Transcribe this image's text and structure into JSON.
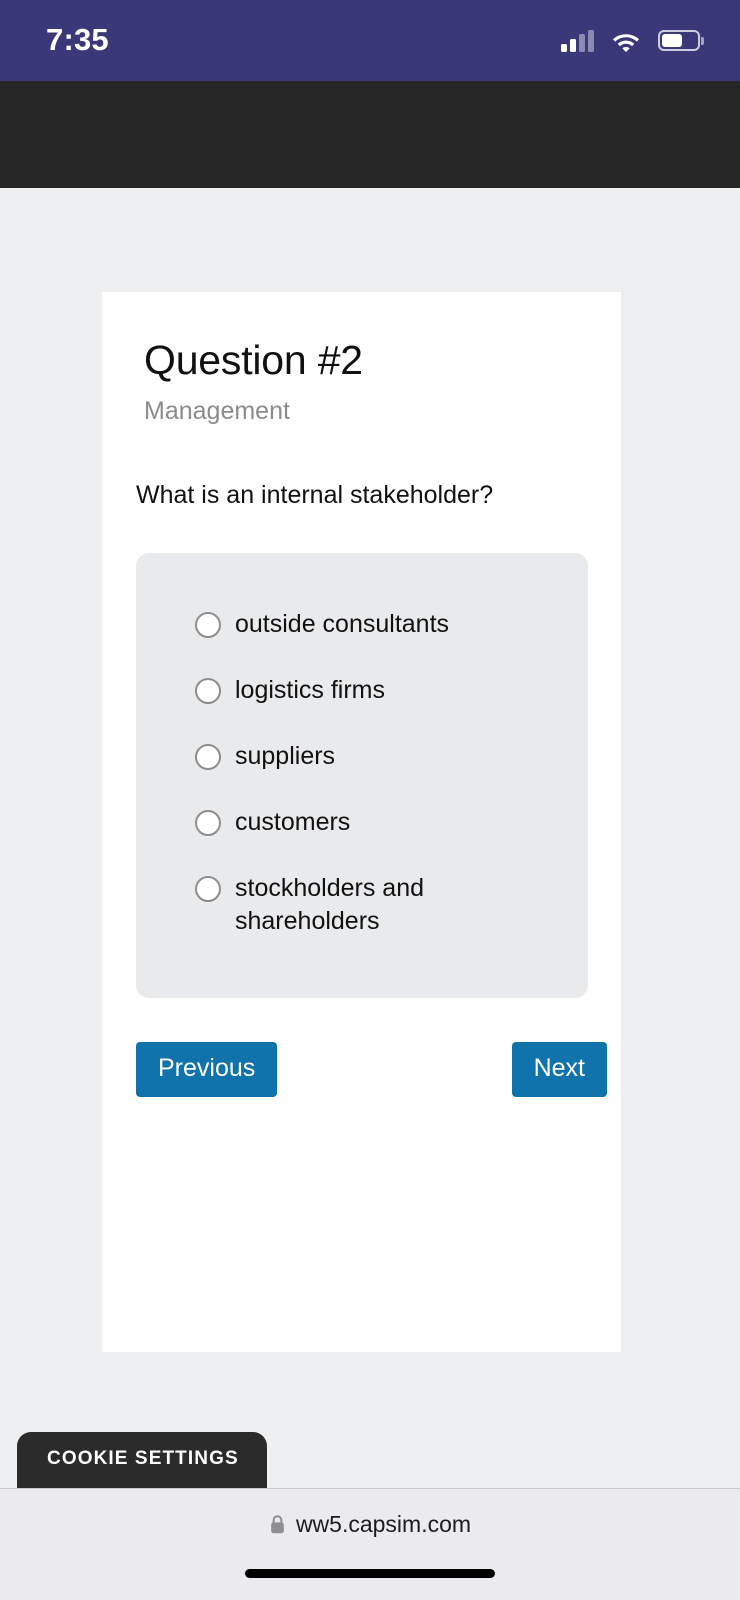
{
  "status_bar": {
    "time": "7:35",
    "background_color": "#3b3879",
    "signal_icon": "cellular-signal-icon",
    "signal_bars_filled": 2,
    "signal_bars_total": 4,
    "wifi_icon": "wifi-icon",
    "battery_icon": "battery-icon",
    "battery_level_percent": 58
  },
  "browser_chrome": {
    "top_band_color": "#262626"
  },
  "quiz": {
    "title": "Question #2",
    "category": "Management",
    "prompt": "What is an internal stakeholder?",
    "options": [
      {
        "label": "outside consultants",
        "selected": false
      },
      {
        "label": "logistics firms",
        "selected": false
      },
      {
        "label": "suppliers",
        "selected": false
      },
      {
        "label": "customers",
        "selected": false
      },
      {
        "label": "stockholders and shareholders",
        "selected": false
      }
    ],
    "previous_label": "Previous",
    "next_label": "Next",
    "button_color": "#1073ab",
    "panel_color": "#e9eaec"
  },
  "cookie_banner": {
    "label": "COOKIE SETTINGS",
    "background_color": "#2b2b2b"
  },
  "browser_bottom": {
    "lock_icon": "lock-icon",
    "url": "ww5.capsim.com"
  }
}
